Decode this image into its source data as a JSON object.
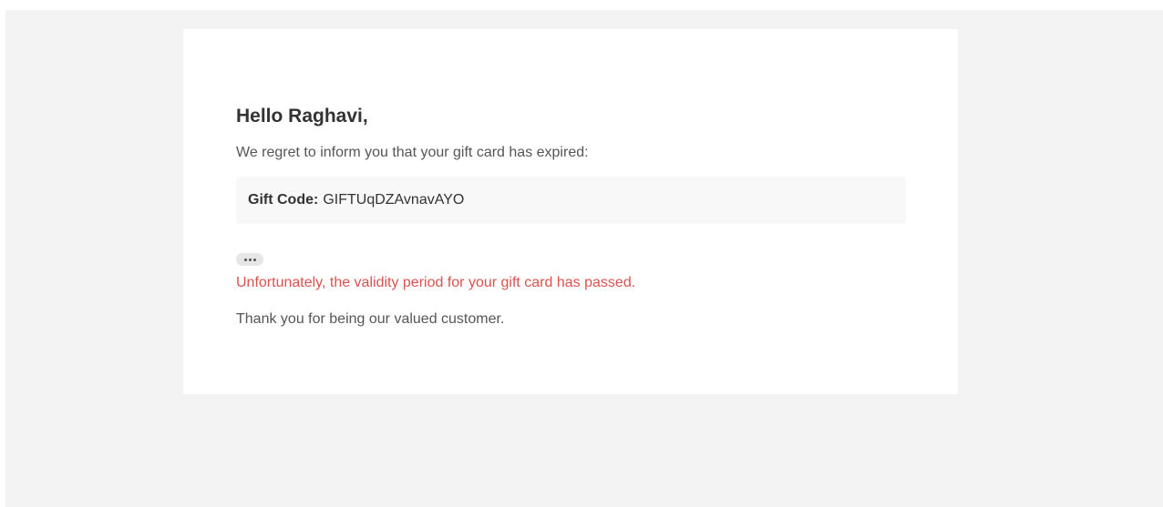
{
  "email": {
    "greeting": "Hello Raghavi,",
    "intro": "We regret to inform you that your gift card has expired:",
    "gift_code_label": "Gift Code:",
    "gift_code_value": "GIFTUqDZAvnavAYO",
    "warning": "Unfortunately, the validity period for your gift card has passed.",
    "thanks": "Thank you for being our valued customer."
  },
  "controls": {
    "show_trimmed_icon": "ellipsis-icon"
  },
  "colors": {
    "background": "#f3f3f3",
    "card": "#ffffff",
    "code_box": "#f8f8f8",
    "warning_text": "#d9534f",
    "body_text": "#555555",
    "heading_text": "#333333"
  }
}
